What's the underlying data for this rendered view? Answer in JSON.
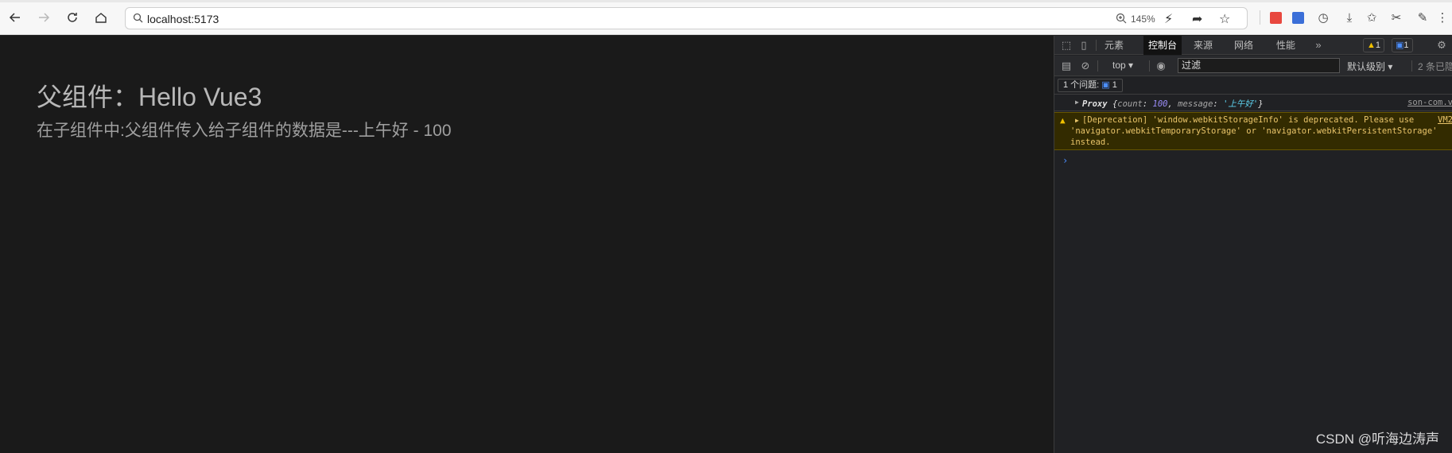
{
  "browser": {
    "url": "localhost:5173",
    "zoom": "145%"
  },
  "page": {
    "heading": "父组件：Hello Vue3",
    "child_line": "在子组件中:父组件传入给子组件的数据是---上午好 - 100"
  },
  "devtools": {
    "tabs": [
      "元素",
      "控制台",
      "来源",
      "网络",
      "性能"
    ],
    "active_tab": "控制台",
    "warn_count": "1",
    "msg_count": "1",
    "context": "top",
    "filter_value": "过滤",
    "level": "默认级别",
    "hidden": "2 条已隐",
    "issues_label": "1 个问题:",
    "issues_count": "1",
    "log": {
      "label": "Proxy",
      "open": "{",
      "k1": "count",
      "v1": "100",
      "k2": "message",
      "v2": "'上午好'",
      "close": "}",
      "source": "son-com.v"
    },
    "warning": {
      "line1": "[Deprecation] 'window.webkitStorageInfo' is deprecated. Please use",
      "line2": "'navigator.webkitTemporaryStorage' or 'navigator.webkitPersistentStorage'",
      "line3": "instead.",
      "source": "VM2"
    },
    "prompt": "›"
  },
  "watermark": "CSDN @听海边涛声",
  "colors": {
    "page_bg": "#1a1a1a",
    "devtools_bg": "#202124",
    "warning_bg": "#332b00",
    "warning_text": "#e9c46a",
    "accent_blue": "#1a73e8"
  }
}
